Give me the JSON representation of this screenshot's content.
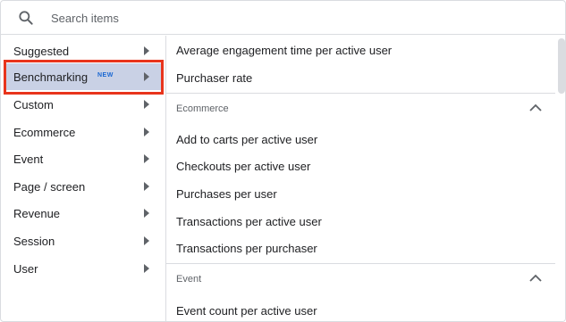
{
  "search": {
    "placeholder": "Search items"
  },
  "categories": [
    {
      "label": "Suggested"
    },
    {
      "label": "Benchmarking",
      "badge": "NEW",
      "selected": true
    },
    {
      "label": "Custom"
    },
    {
      "label": "Ecommerce"
    },
    {
      "label": "Event"
    },
    {
      "label": "Page / screen"
    },
    {
      "label": "Revenue"
    },
    {
      "label": "Session"
    },
    {
      "label": "User"
    }
  ],
  "metrics": {
    "ungrouped": [
      "Average engagement time per active user",
      "Purchaser rate"
    ],
    "ecommerce": {
      "title": "Ecommerce",
      "items": [
        "Add to carts per active user",
        "Checkouts per active user",
        "Purchases per user",
        "Transactions per active user",
        "Transactions per purchaser"
      ]
    },
    "event": {
      "title": "Event",
      "items": [
        "Event count per active user"
      ]
    }
  },
  "icons": {
    "search": "search-icon",
    "chevron": "chevron-right-icon",
    "collapse": "chevron-up-icon"
  },
  "colors": {
    "selected_background": "#c9d1e5",
    "highlight_border": "#e8341c",
    "badge": "#1967d2"
  }
}
